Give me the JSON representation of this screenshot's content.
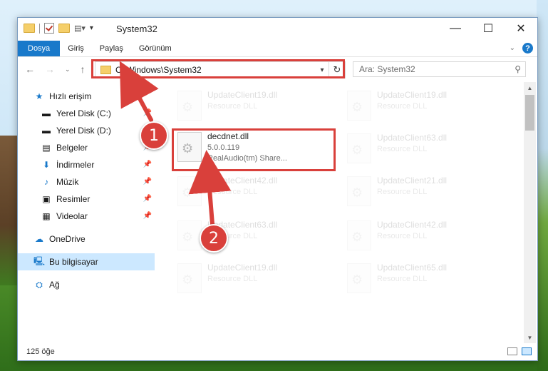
{
  "window": {
    "title": "System32"
  },
  "ribbon": {
    "tabs": [
      "Dosya",
      "Giriş",
      "Paylaş",
      "Görünüm"
    ]
  },
  "address": {
    "path": "C:\\Windows\\System32"
  },
  "search": {
    "placeholder": "Ara: System32"
  },
  "sidebar": {
    "items": [
      {
        "label": "Hızlı erişim",
        "icon": "star-icon",
        "pinned": false
      },
      {
        "label": "Yerel Disk (C:)",
        "icon": "drive-icon",
        "pinned": true
      },
      {
        "label": "Yerel Disk (D:)",
        "icon": "drive-icon",
        "pinned": true
      },
      {
        "label": "Belgeler",
        "icon": "documents-icon",
        "pinned": true
      },
      {
        "label": "İndirmeler",
        "icon": "download-icon",
        "pinned": true
      },
      {
        "label": "Müzik",
        "icon": "music-icon",
        "pinned": true
      },
      {
        "label": "Resimler",
        "icon": "pictures-icon",
        "pinned": true
      },
      {
        "label": "Videolar",
        "icon": "video-icon",
        "pinned": true
      },
      {
        "label": "OneDrive",
        "icon": "cloud-icon",
        "pinned": false
      },
      {
        "label": "Bu bilgisayar",
        "icon": "computer-icon",
        "pinned": false,
        "selected": true
      },
      {
        "label": "Ağ",
        "icon": "network-icon",
        "pinned": false
      }
    ]
  },
  "files": {
    "left": [
      {
        "name": "UpdateClient19.dll",
        "type": "Resource DLL"
      },
      {
        "name": "decdnet.dll",
        "version": "5.0.0.119",
        "company": "RealAudio(tm) Share..."
      },
      {
        "name": "UpdateClient42.dll",
        "type": "Resource DLL"
      },
      {
        "name": "UpdateClient63.dll",
        "type": "Resource DLL"
      },
      {
        "name": "UpdateClient19.dll",
        "type": "Resource DLL"
      }
    ],
    "right": [
      {
        "name": "UpdateClient19.dll",
        "type": "Resource DLL"
      },
      {
        "name": "UpdateClient63.dll",
        "type": "Resource DLL"
      },
      {
        "name": "UpdateClient21.dll",
        "type": "Resource DLL"
      },
      {
        "name": "UpdateClient42.dll",
        "type": "Resource DLL"
      },
      {
        "name": "UpdateClient65.dll",
        "type": "Resource DLL"
      }
    ]
  },
  "status": {
    "count": "125 öğe"
  },
  "callouts": {
    "one": "1",
    "two": "2"
  },
  "colors": {
    "accent": "#1979ca",
    "highlight": "#d9403b",
    "selection": "#cce8ff"
  }
}
